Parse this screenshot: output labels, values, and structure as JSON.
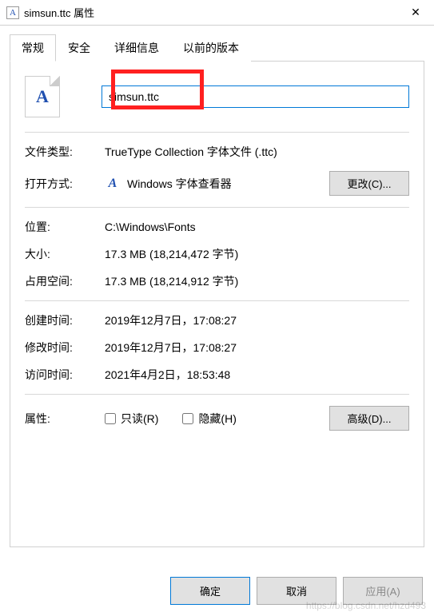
{
  "titlebar": {
    "title": "simsun.ttc 属性",
    "close_glyph": "✕"
  },
  "tabs": {
    "general": "常规",
    "security": "安全",
    "details": "详细信息",
    "previous": "以前的版本"
  },
  "file": {
    "icon_letter": "A",
    "name": "simsun.ttc"
  },
  "labels": {
    "file_type": "文件类型:",
    "opens_with": "打开方式:",
    "location": "位置:",
    "size": "大小:",
    "size_on_disk": "占用空间:",
    "created": "创建时间:",
    "modified": "修改时间:",
    "accessed": "访问时间:",
    "attributes": "属性:"
  },
  "values": {
    "file_type": "TrueType Collection 字体文件 (.ttc)",
    "opens_with": "Windows 字体查看器",
    "location": "C:\\Windows\\Fonts",
    "size": "17.3 MB (18,214,472 字节)",
    "size_on_disk": "17.3 MB (18,214,912 字节)",
    "created": "2019年12月7日，17:08:27",
    "modified": "2019年12月7日，17:08:27",
    "accessed": "2021年4月2日，18:53:48"
  },
  "buttons": {
    "change": "更改(C)...",
    "advanced": "高级(D)...",
    "ok": "确定",
    "cancel": "取消",
    "apply": "应用(A)"
  },
  "checkboxes": {
    "readonly": "只读(R)",
    "hidden": "隐藏(H)"
  },
  "watermark": "https://blog.csdn.net/hzd493"
}
